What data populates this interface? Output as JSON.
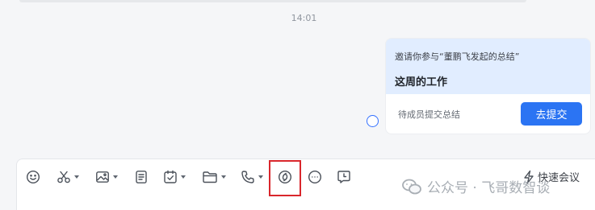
{
  "chat": {
    "timestamp": "14:01",
    "card": {
      "invite_text": "邀请你参与“董鹏飞发起的总结”",
      "title": "这周的工作",
      "pending_text": "待成员提交总结",
      "button_label": "去提交",
      "header_color": "#e1edff",
      "button_color": "#2b74f3"
    }
  },
  "toolbar": {
    "tools": [
      {
        "icon": "emoji-icon"
      },
      {
        "icon": "scissors-icon",
        "has_dropdown": true
      },
      {
        "icon": "image-icon",
        "has_dropdown": true
      },
      {
        "icon": "document-icon"
      },
      {
        "icon": "task-check-icon",
        "has_dropdown": true
      },
      {
        "icon": "folder-icon",
        "has_dropdown": true
      },
      {
        "icon": "phone-icon",
        "has_dropdown": true
      },
      {
        "icon": "summary-icon",
        "highlighted": true
      },
      {
        "icon": "more-icon"
      },
      {
        "icon": "schedule-icon"
      }
    ],
    "quick_meeting_label": "快速会议",
    "highlight_color": "#d9262c"
  },
  "watermark": {
    "text": "公众号 · 飞哥数智谈"
  }
}
